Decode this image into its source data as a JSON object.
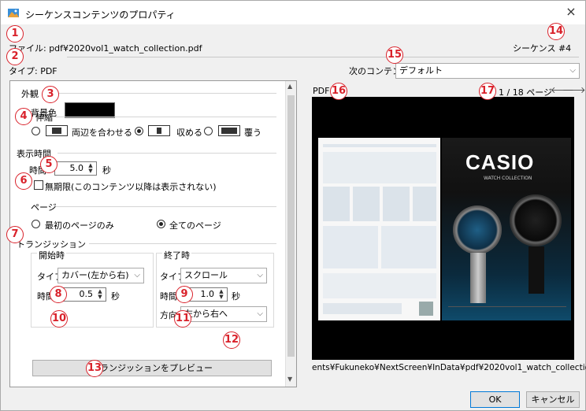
{
  "window": {
    "title": "シーケンスコンテンツのプロパティ",
    "close": "×"
  },
  "file_line": "ファイル: pdf¥2020vol1_watch_collection.pdf",
  "type_line": "タイプ: PDF",
  "sequence_label": "シーケンス #4",
  "next_content": {
    "label": "次のコンテンツ",
    "value": "デフォルト"
  },
  "appearance": {
    "group": "外観",
    "bg_label": "背景色",
    "bg_color": "#000000"
  },
  "stretch": {
    "group": "伸縮",
    "options": [
      {
        "label": "両辺を合わせる",
        "selected": false
      },
      {
        "label": "収める",
        "selected": true
      },
      {
        "label": "覆う",
        "selected": false
      }
    ]
  },
  "display_time": {
    "group": "表示時間",
    "time_label": "時間",
    "time_value": "5.0",
    "unit": "秒",
    "infinite_label": "無期限(このコンテンツ以降は表示されない)",
    "infinite_checked": false
  },
  "pages": {
    "group": "ページ",
    "options": [
      {
        "label": "最初のページのみ",
        "selected": false
      },
      {
        "label": "全てのページ",
        "selected": true
      }
    ]
  },
  "transition": {
    "group": "トランジッション",
    "start": {
      "group": "開始時",
      "type_label": "タイプ",
      "type_value": "カバー(左から右)",
      "time_label": "時間",
      "time_value": "0.5",
      "unit": "秒"
    },
    "end": {
      "group": "終了時",
      "type_label": "タイプ",
      "type_value": "スクロール",
      "time_label": "時間",
      "time_value": "1.0",
      "unit": "秒",
      "dir_label": "方向",
      "dir_value": "左から右へ"
    },
    "preview_button": "トランジッションをプレビュー"
  },
  "preview": {
    "label": "PDF",
    "page_text": "1 / 18 ページ",
    "path": "ents¥Fukuneko¥NextScreen¥InData¥pdf¥2020vol1_watch_collection.pdf",
    "ad_brand": "CASIO",
    "ad_sub": "WATCH COLLECTION"
  },
  "buttons": {
    "ok": "OK",
    "cancel": "キャンセル"
  },
  "badges": [
    "1",
    "2",
    "3",
    "4",
    "5",
    "6",
    "7",
    "8",
    "9",
    "10",
    "11",
    "12",
    "13",
    "14",
    "15",
    "16",
    "17"
  ],
  "colors": {
    "badge": "#d9212a",
    "accent": "#0078d7"
  }
}
